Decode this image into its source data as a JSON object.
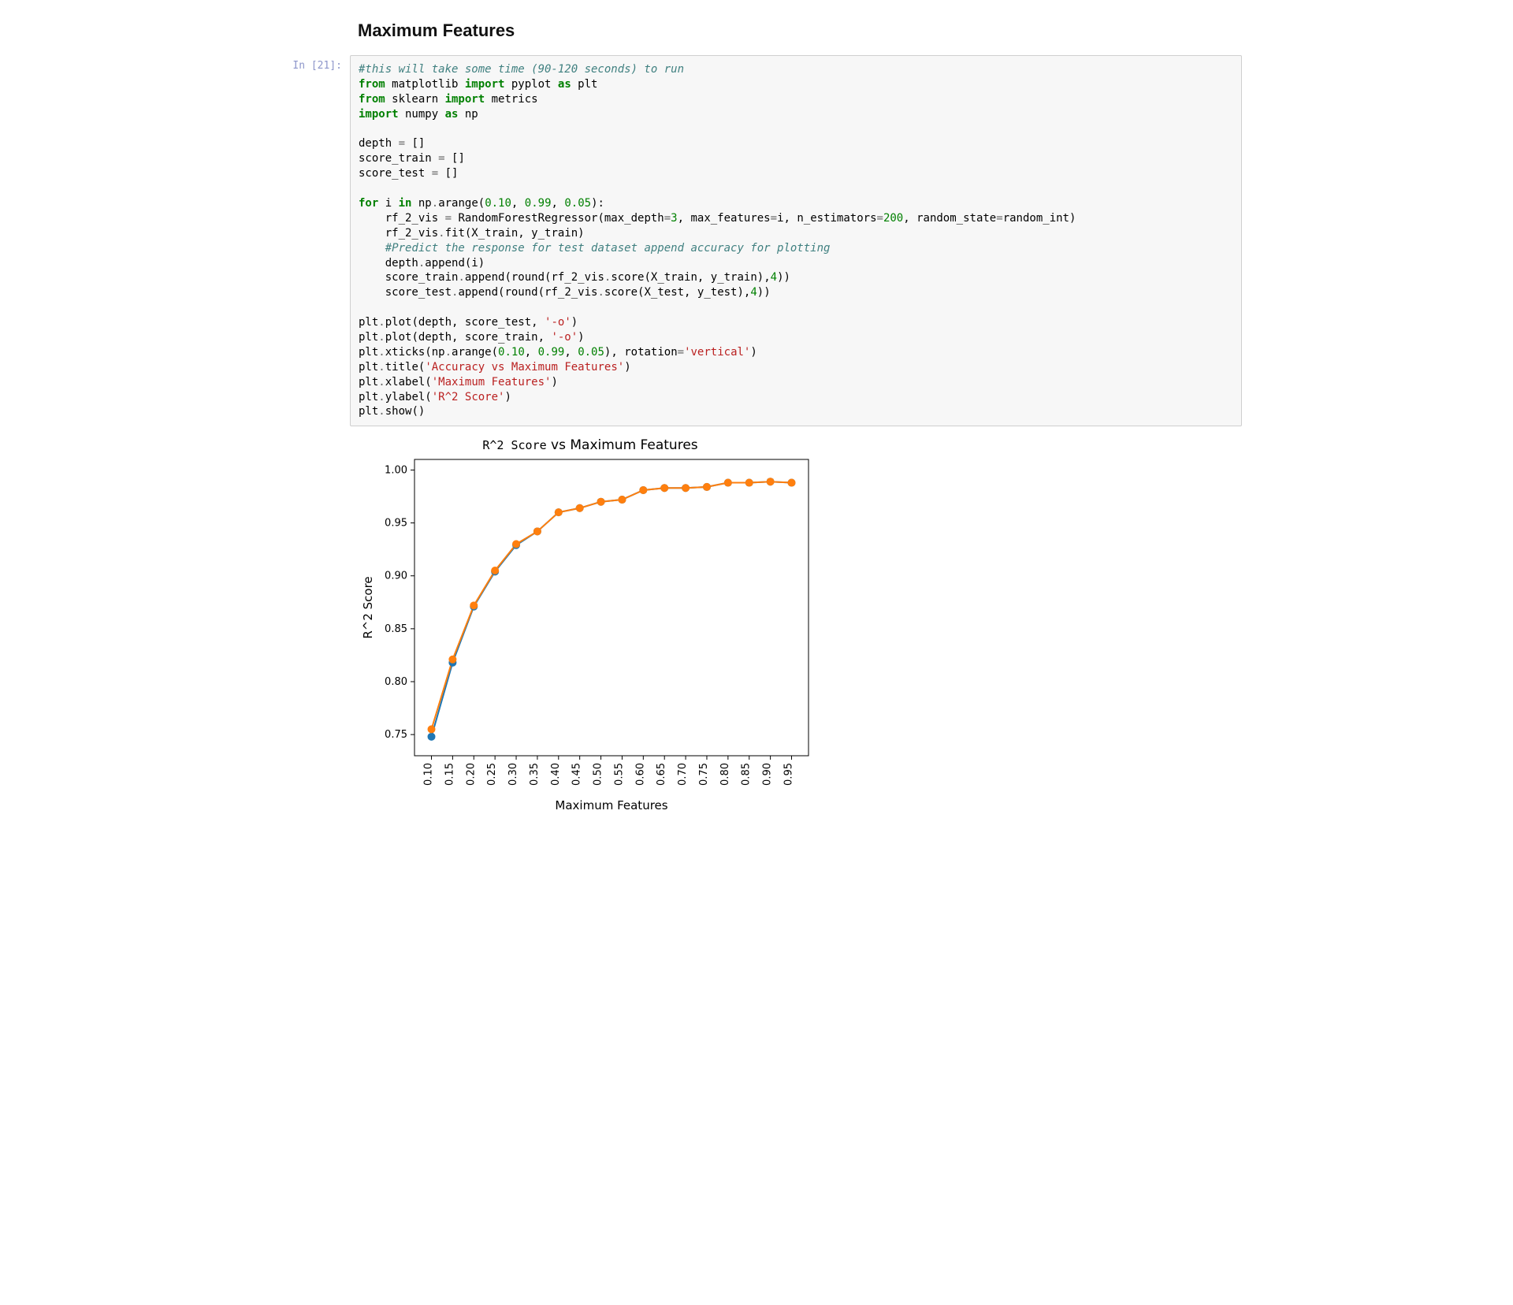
{
  "heading": "Maximum Features",
  "prompt": "In [21]:",
  "code_lines": [
    [
      [
        "comment",
        "#this will take some time (90-120 seconds) to run"
      ]
    ],
    [
      [
        "keyword",
        "from"
      ],
      [
        "name",
        " matplotlib "
      ],
      [
        "keyword",
        "import"
      ],
      [
        "name",
        " pyplot "
      ],
      [
        "keyword",
        "as"
      ],
      [
        "name",
        " plt"
      ]
    ],
    [
      [
        "keyword",
        "from"
      ],
      [
        "name",
        " sklearn "
      ],
      [
        "keyword",
        "import"
      ],
      [
        "name",
        " metrics"
      ]
    ],
    [
      [
        "keyword",
        "import"
      ],
      [
        "name",
        " numpy "
      ],
      [
        "keyword",
        "as"
      ],
      [
        "name",
        " np"
      ]
    ],
    [
      [
        "name",
        ""
      ]
    ],
    [
      [
        "name",
        "depth "
      ],
      [
        "op",
        "="
      ],
      [
        "name",
        " []"
      ]
    ],
    [
      [
        "name",
        "score_train "
      ],
      [
        "op",
        "="
      ],
      [
        "name",
        " []"
      ]
    ],
    [
      [
        "name",
        "score_test "
      ],
      [
        "op",
        "="
      ],
      [
        "name",
        " []"
      ]
    ],
    [
      [
        "name",
        ""
      ]
    ],
    [
      [
        "keyword",
        "for"
      ],
      [
        "name",
        " i "
      ],
      [
        "keyword",
        "in"
      ],
      [
        "name",
        " np"
      ],
      [
        "op",
        "."
      ],
      [
        "name",
        "arange("
      ],
      [
        "num",
        "0.10"
      ],
      [
        "name",
        ", "
      ],
      [
        "num",
        "0.99"
      ],
      [
        "name",
        ", "
      ],
      [
        "num",
        "0.05"
      ],
      [
        "name",
        "):"
      ]
    ],
    [
      [
        "name",
        "    rf_2_vis "
      ],
      [
        "op",
        "="
      ],
      [
        "name",
        " RandomForestRegressor(max_depth"
      ],
      [
        "op",
        "="
      ],
      [
        "num",
        "3"
      ],
      [
        "name",
        ", max_features"
      ],
      [
        "op",
        "="
      ],
      [
        "name",
        "i, n_estimators"
      ],
      [
        "op",
        "="
      ],
      [
        "num",
        "200"
      ],
      [
        "name",
        ", random_state"
      ],
      [
        "op",
        "="
      ],
      [
        "name",
        "random_int)"
      ]
    ],
    [
      [
        "name",
        "    rf_2_vis"
      ],
      [
        "op",
        "."
      ],
      [
        "name",
        "fit(X_train, y_train)"
      ]
    ],
    [
      [
        "name",
        "    "
      ],
      [
        "comment",
        "#Predict the response for test dataset append accuracy for plotting"
      ]
    ],
    [
      [
        "name",
        "    depth"
      ],
      [
        "op",
        "."
      ],
      [
        "name",
        "append(i)"
      ]
    ],
    [
      [
        "name",
        "    score_train"
      ],
      [
        "op",
        "."
      ],
      [
        "name",
        "append(round(rf_2_vis"
      ],
      [
        "op",
        "."
      ],
      [
        "name",
        "score(X_train, y_train),"
      ],
      [
        "num",
        "4"
      ],
      [
        "name",
        "))"
      ]
    ],
    [
      [
        "name",
        "    score_test"
      ],
      [
        "op",
        "."
      ],
      [
        "name",
        "append(round(rf_2_vis"
      ],
      [
        "op",
        "."
      ],
      [
        "name",
        "score(X_test, y_test),"
      ],
      [
        "num",
        "4"
      ],
      [
        "name",
        "))"
      ]
    ],
    [
      [
        "name",
        ""
      ]
    ],
    [
      [
        "name",
        "plt"
      ],
      [
        "op",
        "."
      ],
      [
        "name",
        "plot(depth, score_test, "
      ],
      [
        "str",
        "'-o'"
      ],
      [
        "name",
        ")"
      ]
    ],
    [
      [
        "name",
        "plt"
      ],
      [
        "op",
        "."
      ],
      [
        "name",
        "plot(depth, score_train, "
      ],
      [
        "str",
        "'-o'"
      ],
      [
        "name",
        ")"
      ]
    ],
    [
      [
        "name",
        "plt"
      ],
      [
        "op",
        "."
      ],
      [
        "name",
        "xticks(np"
      ],
      [
        "op",
        "."
      ],
      [
        "name",
        "arange("
      ],
      [
        "num",
        "0.10"
      ],
      [
        "name",
        ", "
      ],
      [
        "num",
        "0.99"
      ],
      [
        "name",
        ", "
      ],
      [
        "num",
        "0.05"
      ],
      [
        "name",
        "), rotation"
      ],
      [
        "op",
        "="
      ],
      [
        "str",
        "'vertical'"
      ],
      [
        "name",
        ")"
      ]
    ],
    [
      [
        "name",
        "plt"
      ],
      [
        "op",
        "."
      ],
      [
        "name",
        "title("
      ],
      [
        "str",
        "'Accuracy vs Maximum Features'"
      ],
      [
        "name",
        ")"
      ]
    ],
    [
      [
        "name",
        "plt"
      ],
      [
        "op",
        "."
      ],
      [
        "name",
        "xlabel("
      ],
      [
        "str",
        "'Maximum Features'"
      ],
      [
        "name",
        ")"
      ]
    ],
    [
      [
        "name",
        "plt"
      ],
      [
        "op",
        "."
      ],
      [
        "name",
        "ylabel("
      ],
      [
        "str",
        "'R^2 Score'"
      ],
      [
        "name",
        ")"
      ]
    ],
    [
      [
        "name",
        "plt"
      ],
      [
        "op",
        "."
      ],
      [
        "name",
        "show()"
      ]
    ]
  ],
  "chart_data": {
    "type": "line",
    "title_prefix": "R^2 Score",
    "title_suffix": " vs Maximum Features",
    "xlabel": "Maximum Features",
    "ylabel": "R^2 Score",
    "x": [
      0.1,
      0.15,
      0.2,
      0.25,
      0.3,
      0.35,
      0.4,
      0.45,
      0.5,
      0.55,
      0.6,
      0.65,
      0.7,
      0.75,
      0.8,
      0.85,
      0.9,
      0.95
    ],
    "xticks": [
      "0.10",
      "0.15",
      "0.20",
      "0.25",
      "0.30",
      "0.35",
      "0.40",
      "0.45",
      "0.50",
      "0.55",
      "0.60",
      "0.65",
      "0.70",
      "0.75",
      "0.80",
      "0.85",
      "0.90",
      "0.95"
    ],
    "yticks": [
      0.75,
      0.8,
      0.85,
      0.9,
      0.95,
      1.0
    ],
    "ylim": [
      0.73,
      1.01
    ],
    "xlim": [
      0.06,
      0.99
    ],
    "series": [
      {
        "name": "score_test",
        "color": "#1f77b4",
        "values": [
          0.748,
          0.818,
          0.871,
          0.904,
          0.929,
          0.942,
          0.96,
          0.964,
          0.97,
          0.972,
          0.981,
          0.983,
          0.983,
          0.984,
          0.988,
          0.988,
          0.989,
          0.988
        ]
      },
      {
        "name": "score_train",
        "color": "#ff7f0e",
        "values": [
          0.755,
          0.821,
          0.872,
          0.905,
          0.93,
          0.942,
          0.96,
          0.964,
          0.97,
          0.972,
          0.981,
          0.983,
          0.983,
          0.984,
          0.988,
          0.988,
          0.989,
          0.988
        ]
      }
    ]
  }
}
